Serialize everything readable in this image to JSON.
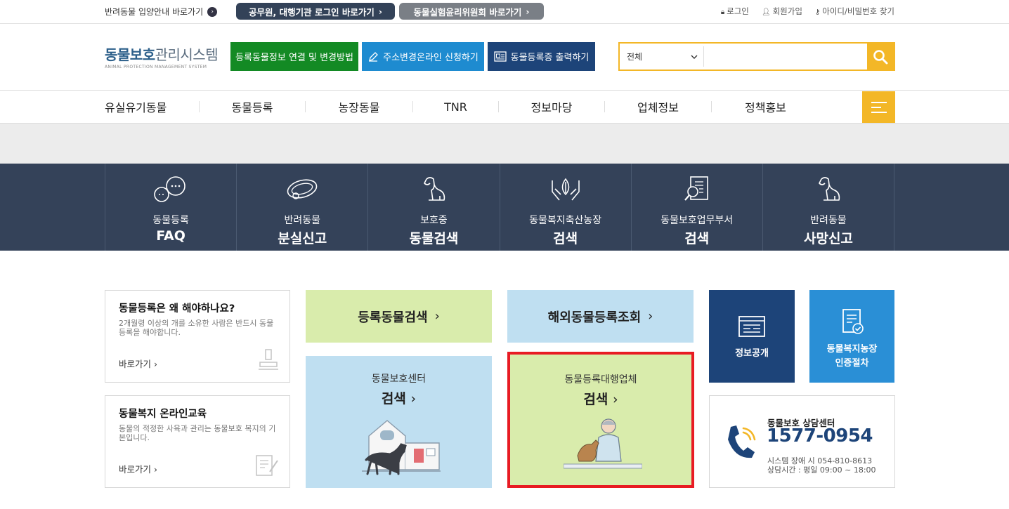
{
  "topbar": {
    "guide_label": "반려동물 입양안내 바로가기",
    "pill1_label": "공무원, 대행기관 로그인 바로가기",
    "pill2_label": "동물실험윤리위원회 바로가기",
    "login": "로그인",
    "signup": "회원가입",
    "find": "아이디/비밀번호 찾기"
  },
  "header": {
    "logo_main": "동물보호",
    "logo_sub": "관리시스템",
    "logo_en": "ANIMAL PROTECTION MANAGEMENT SYSTEM",
    "btn1": "등록동물정보 연결 및 변경방법",
    "btn2": "주소변경온라인 신청하기",
    "btn3": "동물등록증 출력하기",
    "search_select": "전체",
    "search_placeholder": ""
  },
  "nav": {
    "items": [
      "유실유기동물",
      "동물등록",
      "농장동물",
      "TNR",
      "정보마당",
      "업체정보",
      "정책홍보"
    ]
  },
  "quick": [
    {
      "line1": "동물등록",
      "line2": "FAQ",
      "icon": "chat-bubbles-icon"
    },
    {
      "line1": "반려동물",
      "line2": "분실신고",
      "icon": "pet-collar-icon"
    },
    {
      "line1": "보호중",
      "line2": "동물검색",
      "icon": "dog-icon"
    },
    {
      "line1": "동물복지축산농장",
      "line2": "검색",
      "icon": "hands-leaf-icon"
    },
    {
      "line1": "동물보호업무부서",
      "line2": "검색",
      "icon": "document-search-icon"
    },
    {
      "line1": "반려동물",
      "line2": "사망신고",
      "icon": "dog-icon"
    }
  ],
  "cards": {
    "why": {
      "title": "동물등록은 왜 해야하나요?",
      "desc": "2개월령 이상의 개를 소유한 사람은 반드시 동물등록을 해야합니다.",
      "link": "바로가기"
    },
    "edu": {
      "title": "동물복지 온라인교육",
      "desc": "동물의 적정한 사육과 관리는 동물보호 복지의 기본입니다.",
      "link": "바로가기"
    },
    "reg_search": "등록동물검색",
    "overseas": "해외동물등록조회",
    "center": {
      "line1": "동물보호센터",
      "line2": "검색"
    },
    "agency": {
      "line1": "동물등록대행업체",
      "line2": "검색"
    },
    "info_open": "정보공개",
    "farm_cert": {
      "line1": "동물복지농장",
      "line2": "인증절차"
    },
    "counsel": {
      "title": "동물보호 상담센터",
      "phone": "1577-0954",
      "note1": "시스템 장애 시 054-810-8613",
      "note2": "상담시간 : 평일 09:00 ~ 18:00"
    }
  },
  "colors": {
    "navy": "#344259",
    "yellow": "#f3b727",
    "green_btn": "#138a24",
    "blue_btn": "#1e8bd0",
    "darkblue_btn": "#1d4479",
    "light_green": "#d9ecac",
    "light_blue": "#bfdff1",
    "tile_navy": "#1d4479",
    "tile_blue": "#2a8fd6",
    "highlight": "#e81b23"
  }
}
